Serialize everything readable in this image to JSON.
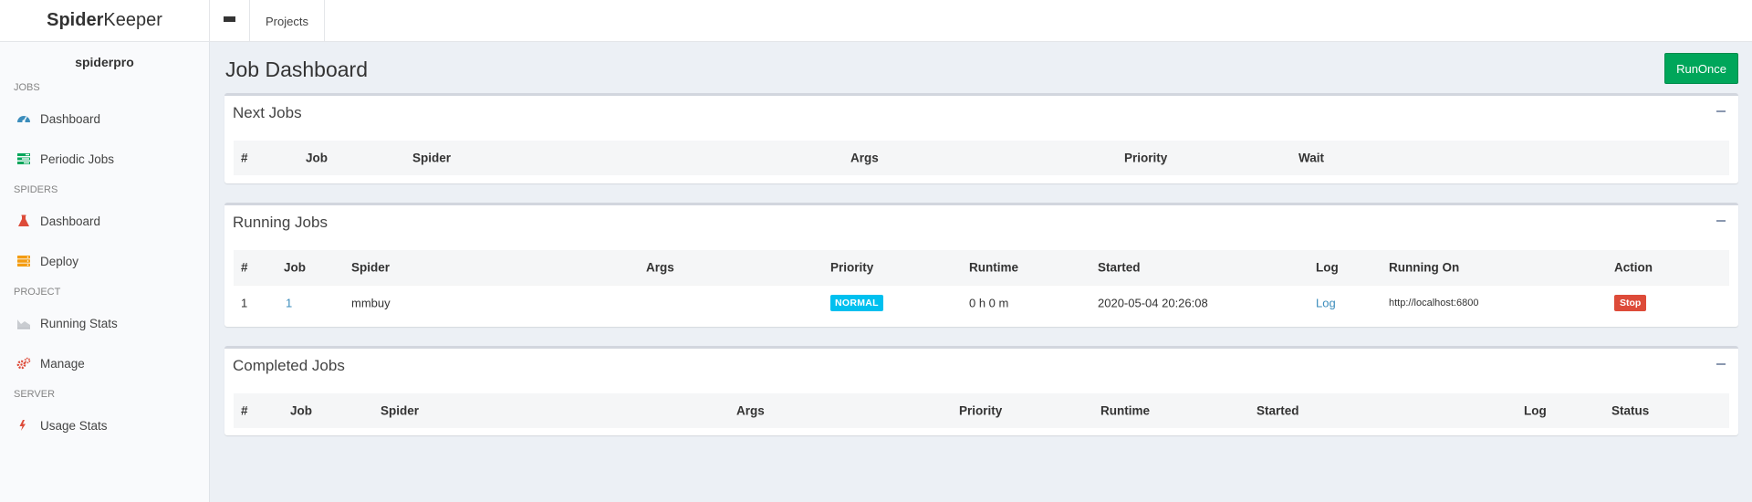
{
  "header": {
    "logo_bold": "Spider",
    "logo_light": "Keeper",
    "projects_label": "Projects"
  },
  "sidebar": {
    "user": "spiderpro",
    "sections": [
      {
        "title": "JOBS",
        "items": [
          {
            "label": "Dashboard",
            "icon": "dashboard-icon"
          },
          {
            "label": "Periodic Jobs",
            "icon": "tasks-icon"
          }
        ]
      },
      {
        "title": "SPIDERS",
        "items": [
          {
            "label": "Dashboard",
            "icon": "flask-icon"
          },
          {
            "label": "Deploy",
            "icon": "server-icon"
          }
        ]
      },
      {
        "title": "PROJECT",
        "items": [
          {
            "label": "Running Stats",
            "icon": "area-chart-icon"
          },
          {
            "label": "Manage",
            "icon": "cogs-icon"
          }
        ]
      },
      {
        "title": "SERVER",
        "items": [
          {
            "label": "Usage Stats",
            "icon": "bolt-icon"
          }
        ]
      }
    ]
  },
  "main": {
    "title": "Job Dashboard",
    "run_once_label": "RunOnce",
    "next_jobs": {
      "title": "Next Jobs",
      "columns": [
        "#",
        "Job",
        "Spider",
        "Args",
        "Priority",
        "Wait"
      ]
    },
    "running_jobs": {
      "title": "Running Jobs",
      "columns": [
        "#",
        "Job",
        "Spider",
        "Args",
        "Priority",
        "Runtime",
        "Started",
        "Log",
        "Running On",
        "Action"
      ],
      "rows": [
        {
          "num": "1",
          "job": "1",
          "spider": "mmbuy",
          "args": "",
          "priority": "NORMAL",
          "runtime": "0 h 0 m",
          "started": "2020-05-04 20:26:08",
          "log": "Log",
          "running_on": "http://localhost:6800",
          "action": "Stop"
        }
      ]
    },
    "completed_jobs": {
      "title": "Completed Jobs",
      "columns": [
        "#",
        "Job",
        "Spider",
        "Args",
        "Priority",
        "Runtime",
        "Started",
        "Log",
        "Status"
      ]
    }
  },
  "colors": {
    "accent_green": "#00a65a",
    "badge_info": "#00c0ef",
    "danger": "#dd4b39",
    "link": "#3c8dbc"
  }
}
